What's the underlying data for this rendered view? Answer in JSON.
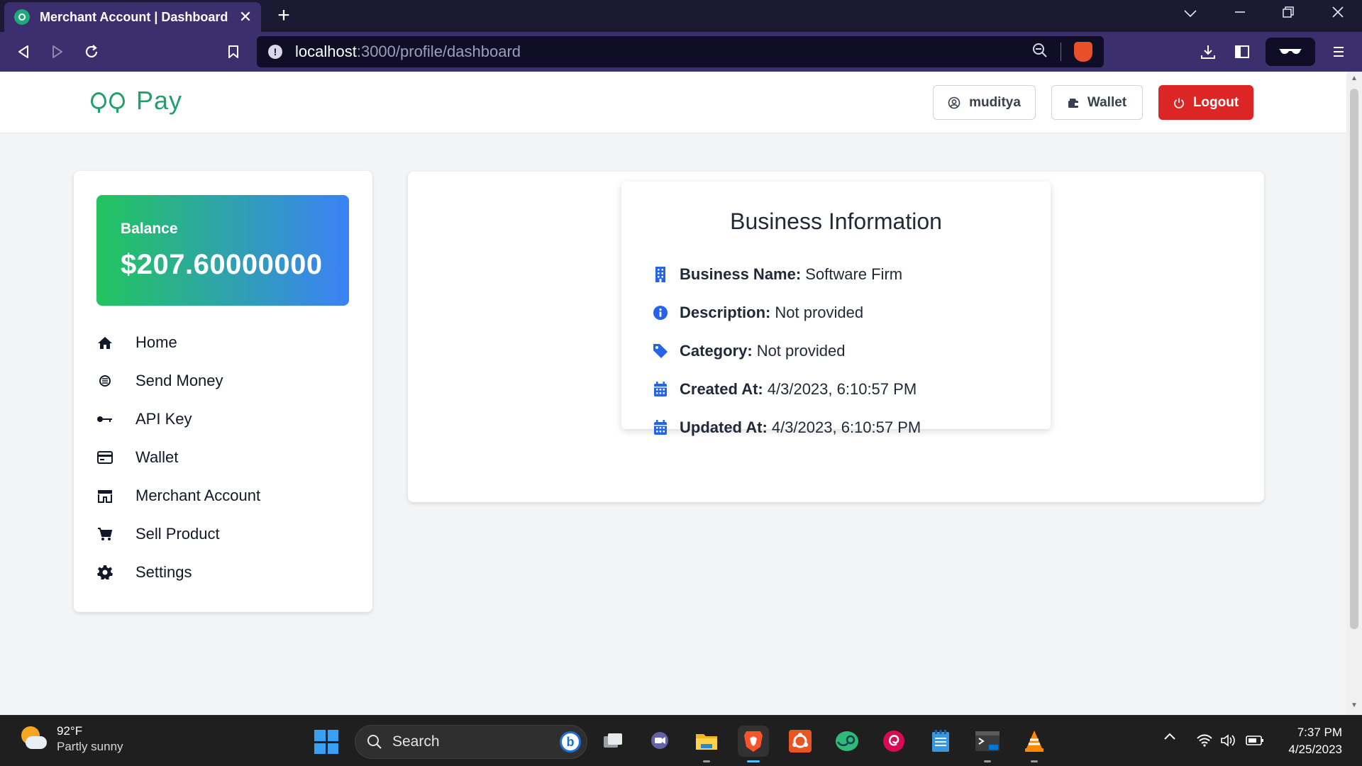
{
  "browser": {
    "tab_title": "Merchant Account | Dashboard",
    "tab_close": "✕",
    "new_tab": "+",
    "url_host": "localhost",
    "url_path": ":3000/profile/dashboard",
    "url_info": "!"
  },
  "header": {
    "logo_text": "Pay",
    "user_button": "muditya",
    "wallet_button": "Wallet",
    "logout_button": "Logout"
  },
  "sidebar": {
    "balance_label": "Balance",
    "balance_value": "$207.60000000",
    "items": [
      {
        "label": "Home",
        "icon": "home-icon"
      },
      {
        "label": "Send Money",
        "icon": "send-money-icon"
      },
      {
        "label": "API Key",
        "icon": "key-icon"
      },
      {
        "label": "Wallet",
        "icon": "credit-card-icon"
      },
      {
        "label": "Merchant Account",
        "icon": "store-icon"
      },
      {
        "label": "Sell Product",
        "icon": "cart-icon"
      },
      {
        "label": "Settings",
        "icon": "gear-icon"
      }
    ]
  },
  "business": {
    "title": "Business Information",
    "rows": [
      {
        "label": "Business Name:",
        "value": "Software Firm",
        "icon": "building-icon"
      },
      {
        "label": "Description:",
        "value": "Not provided",
        "icon": "info-icon"
      },
      {
        "label": "Category:",
        "value": "Not provided",
        "icon": "tag-icon"
      },
      {
        "label": "Created At:",
        "value": "4/3/2023, 6:10:57 PM",
        "icon": "calendar-icon"
      },
      {
        "label": "Updated At:",
        "value": "4/3/2023, 6:10:57 PM",
        "icon": "calendar-icon"
      }
    ]
  },
  "taskbar": {
    "weather_temp": "92°F",
    "weather_desc": "Partly sunny",
    "search_placeholder": "Search",
    "bing_label": "b",
    "time": "7:37 PM",
    "date": "4/25/2023"
  },
  "colors": {
    "brand_green": "#22a06b",
    "logout_red": "#dc2626",
    "icon_blue": "#2563eb",
    "browser_purple": "#3b2f6e"
  }
}
